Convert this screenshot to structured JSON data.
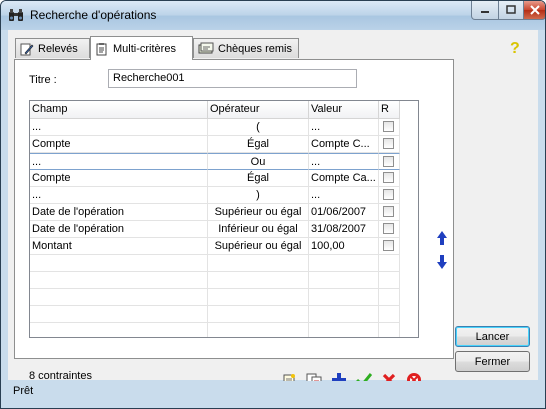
{
  "window": {
    "title": "Recherche d'opérations"
  },
  "tabs": [
    {
      "label": "Relevés",
      "icon": "pen-document-icon"
    },
    {
      "label": "Multi-critères",
      "icon": "clipboard-document-icon"
    },
    {
      "label": "Chèques remis",
      "icon": "cheque-icon"
    }
  ],
  "help": {
    "symbol": "?"
  },
  "form": {
    "title_label": "Titre :",
    "title_value": "Recherche001"
  },
  "grid": {
    "headers": [
      "Champ",
      "Opérateur",
      "Valeur",
      "R"
    ],
    "rows": [
      {
        "champ": "...",
        "operateur": "(",
        "valeur": "...",
        "r": false
      },
      {
        "champ": "Compte",
        "operateur": "Égal",
        "valeur": "Compte C...",
        "r": false
      },
      {
        "champ": "...",
        "operateur": "Ou",
        "valeur": "...",
        "r": false
      },
      {
        "champ": "Compte",
        "operateur": "Égal",
        "valeur": "Compte Ca...",
        "r": false
      },
      {
        "champ": "...",
        "operateur": ")",
        "valeur": "...",
        "r": false
      },
      {
        "champ": "Date de l'opération",
        "operateur": "Supérieur ou égal",
        "valeur": "01/06/2007",
        "r": false
      },
      {
        "champ": "Date de l'opération",
        "operateur": "Inférieur ou égal",
        "valeur": "31/08/2007",
        "r": false
      },
      {
        "champ": "Montant",
        "operateur": "Supérieur ou égal",
        "valeur": "100,00",
        "r": false
      }
    ],
    "selected_row": 2
  },
  "count_label": "8 contraintes",
  "toolbar_icons": [
    "new-document-icon",
    "copy-document-icon",
    "add-icon",
    "validate-check-icon",
    "delete-x-icon",
    "clear-all-icon"
  ],
  "buttons": {
    "lancer": "Lancer",
    "fermer": "Fermer"
  },
  "status": {
    "text": "Prêt"
  },
  "colors": {
    "title_gradient_top": "#dbe9f6",
    "frame": "#c9dcec",
    "accent_blue": "#1f3fbf",
    "check_green": "#2fae21",
    "delete_red": "#e02020",
    "selection_border": "#7da2ce"
  }
}
